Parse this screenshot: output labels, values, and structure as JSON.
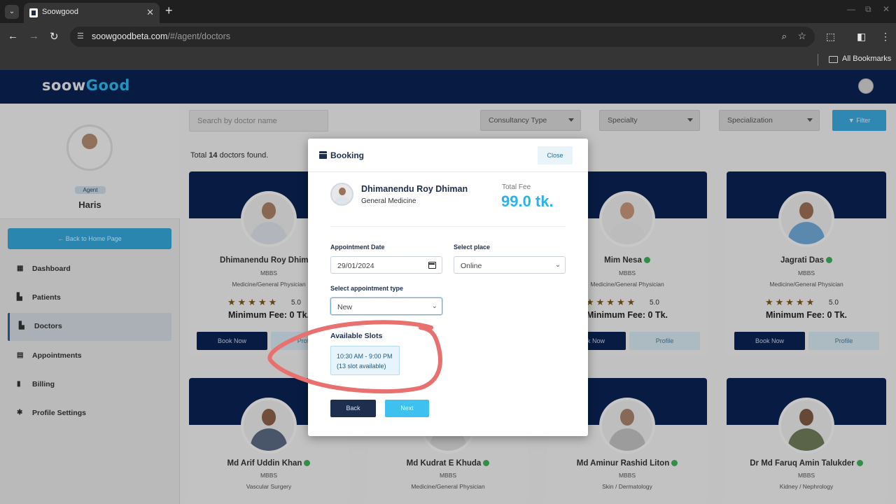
{
  "browser": {
    "tab_title": "Soowgood",
    "url_host": "soowgoodbeta.com",
    "url_path": "/#/agent/doctors",
    "bookmarks_label": "All Bookmarks"
  },
  "app": {
    "logo_main": "soow",
    "logo_accent": "Good"
  },
  "sidebar": {
    "role_badge": "Agent",
    "user_name": "Haris",
    "back_home": "← Back to Home Page",
    "items": [
      {
        "label": "Dashboard",
        "icon": "dashboard-icon"
      },
      {
        "label": "Patients",
        "icon": "bed-icon"
      },
      {
        "label": "Doctors",
        "icon": "bed-icon"
      },
      {
        "label": "Appointments",
        "icon": "calendar-icon"
      },
      {
        "label": "Billing",
        "icon": "billing-icon"
      },
      {
        "label": "Profile Settings",
        "icon": "gear-icon"
      }
    ],
    "active": "Doctors"
  },
  "filters": {
    "search_placeholder": "Search by doctor name",
    "consultancy": "Consultancy Type",
    "specialty": "Specialty",
    "specialization": "Specialization",
    "filter_button": "Filter"
  },
  "results": {
    "prefix": "Total ",
    "count": "14",
    "suffix": " doctors found."
  },
  "cards": [
    {
      "name": "Dhimanendu Roy Dhiman",
      "degree": "MBBS",
      "specialty": "Medicine/General Physician",
      "rating": "5.0",
      "fee": "Minimum Fee: 0 Tk.",
      "book": "Book Now",
      "profile": "Profile"
    },
    {
      "name": "Mim Nesa",
      "degree": "MBBS",
      "specialty": "Medicine/General Physician",
      "rating": "5.0",
      "fee": "Minimum Fee: 0 Tk.",
      "book": "Book Now",
      "profile": "Profile"
    },
    {
      "name": "Jagrati Das",
      "degree": "MBBS",
      "specialty": "Medicine/General Physician",
      "rating": "5.0",
      "fee": "Minimum Fee: 0 Tk.",
      "book": "Book Now",
      "profile": "Profile"
    },
    {
      "name": "Md Arif Uddin Khan",
      "degree": "MBBS",
      "specialty": "Vascular Surgery"
    },
    {
      "name": "Md Kudrat E Khuda",
      "degree": "MBBS",
      "specialty": "Medicine/General Physician"
    },
    {
      "name": "Md Aminur Rashid Liton",
      "degree": "MBBS",
      "specialty": "Skin / Dermatology"
    },
    {
      "name": "Dr Md Faruq Amin Talukder",
      "degree": "MBBS",
      "specialty": "Kidney / Nephrology"
    }
  ],
  "booking": {
    "title": "Booking",
    "close": "Close",
    "doctor_name": "Dhimanendu Roy Dhiman",
    "doctor_specialty": "General Medicine",
    "fee_label": "Total Fee",
    "fee_value": "99.0 tk.",
    "date_label": "Appointment Date",
    "date_value": "29/01/2024",
    "place_label": "Select place",
    "place_value": "Online",
    "type_label": "Select appointment type",
    "type_value": "New",
    "slots_title": "Available Slots",
    "slot_time": "10:30 AM - 9:00 PM",
    "slot_avail": "(13 slot available)",
    "back": "Back",
    "next": "Next"
  },
  "colors": {
    "navy": "#0a2352",
    "accent": "#2bb3e8",
    "annotation": "#e8706f"
  }
}
